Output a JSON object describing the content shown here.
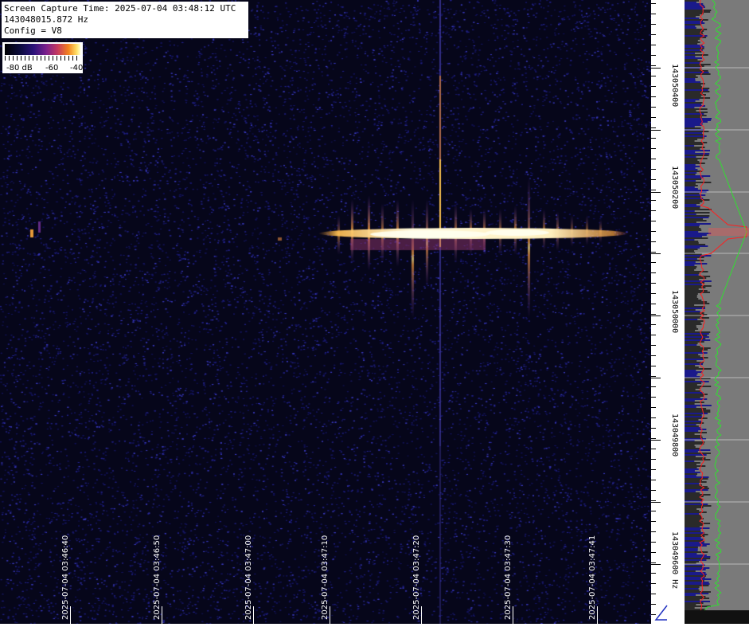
{
  "info": {
    "capture_time": "Screen Capture Time: 2025-07-04 03:48:12 UTC",
    "frequency": "143048015.872 Hz",
    "config": "Config = V8"
  },
  "colorbar": {
    "labels": [
      "-80 dB",
      "-60",
      "-40"
    ]
  },
  "time_axis": {
    "labels": [
      "2025-07-04 03:46:40",
      "2025-07-04 03:46:50",
      "2025-07-04 03:47:00",
      "2025-07-04 03:47:10",
      "2025-07-04 03:47:20",
      "2025-07-04 03:47:30",
      "2025-07-04 03:47:41"
    ]
  },
  "freq_axis": {
    "labels": [
      "143050400",
      "143050200",
      "143050000",
      "143049800",
      "143049600 Hz"
    ]
  },
  "colors": {
    "background": "#06061a",
    "noise": "#2a2a9a",
    "signal_core": "#fff7c0",
    "signal_mid": "#f2a030",
    "spectrum_bg": "#7a7a7a",
    "spectrum_red": "#ff2020",
    "spectrum_green": "#30e030",
    "spectrum_blue": "#1a1a8a"
  }
}
